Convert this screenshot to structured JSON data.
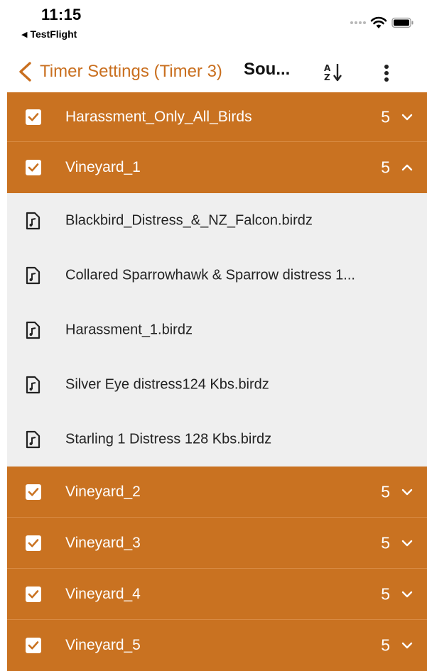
{
  "status_bar": {
    "time": "11:15",
    "back_app": "TestFlight",
    "icons": [
      "signal-dots-icon",
      "wifi-icon",
      "battery-icon"
    ]
  },
  "nav": {
    "back_label": "Timer Settings (Timer 3)",
    "title": "Sou...",
    "back_icon": "chevron-left-icon",
    "sort_icon": "sort-az-icon",
    "more_icon": "more-vertical-icon"
  },
  "colors": {
    "accent": "#c96f1f",
    "folder_bg": "#c97221",
    "file_bg": "#efefef"
  },
  "folders_top": [
    {
      "label": "Harassment_Only_All_Birds",
      "count": "5",
      "checked": true,
      "expanded": false
    },
    {
      "label": "Vineyard_1",
      "count": "5",
      "checked": true,
      "expanded": true
    }
  ],
  "files": [
    {
      "label": "Blackbird_Distress_&_NZ_Falcon.birdz"
    },
    {
      "label": "Collared Sparrowhawk & Sparrow distress 1..."
    },
    {
      "label": "Harassment_1.birdz"
    },
    {
      "label": "Silver Eye distress124 Kbs.birdz"
    },
    {
      "label": "Starling 1 Distress 128 Kbs.birdz"
    }
  ],
  "folders_bottom": [
    {
      "label": "Vineyard_2",
      "count": "5",
      "checked": true,
      "expanded": false
    },
    {
      "label": "Vineyard_3",
      "count": "5",
      "checked": true,
      "expanded": false
    },
    {
      "label": "Vineyard_4",
      "count": "5",
      "checked": true,
      "expanded": false
    },
    {
      "label": "Vineyard_5",
      "count": "5",
      "checked": true,
      "expanded": false
    }
  ]
}
